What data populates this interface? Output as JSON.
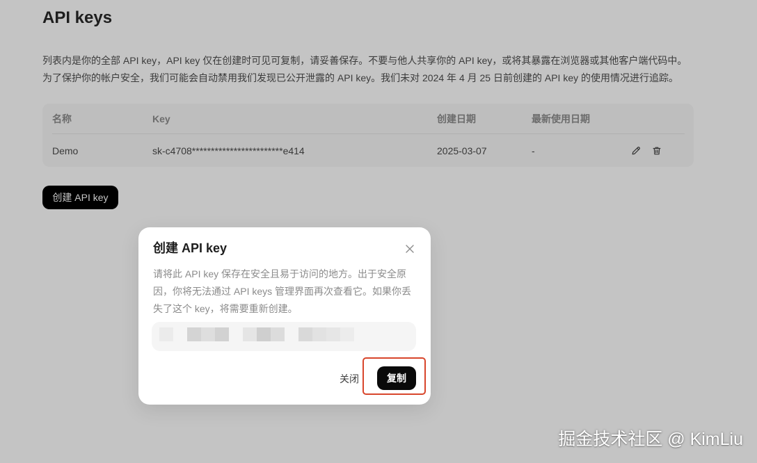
{
  "page": {
    "title": "API keys",
    "description_lines": [
      "列表内是你的全部 API key，API key 仅在创建时可见可复制，请妥善保存。不要与他人共享你的 API key，或将其暴露在浏览器或其他客户端代码中。",
      "为了保护你的帐户安全，我们可能会自动禁用我们发现已公开泄露的 API key。我们未对 2024 年 4 月 25 日前创建的 API key 的使用情况进行追踪。"
    ]
  },
  "table": {
    "columns": [
      "名称",
      "Key",
      "创建日期",
      "最新使用日期"
    ],
    "rows": [
      {
        "name": "Demo",
        "key": "sk-c4708************************e414",
        "created_date": "2025-03-07",
        "last_used_date": "-",
        "action_icons": [
          "pencil-icon",
          "trash-icon"
        ]
      }
    ]
  },
  "create_button": {
    "label": "创建 API key"
  },
  "modal": {
    "title": "创建 API key",
    "close_icon": "close-icon",
    "body_lines": [
      "请将此 API key 保存在安全且易于访问的地方。出于安全原",
      "因，你将无法通过 API keys 管理界面再次查看它。如果你丢",
      "失了这个 key，将需要重新创建。"
    ],
    "close_label": "关闭",
    "copy_label": "复制"
  },
  "watermark": {
    "text": "掘金技术社区 @ KimLiu"
  },
  "colors": {
    "primary_button": "#000000",
    "annotation_highlight": "#d8452b",
    "backdrop": "rgba(0,0,0,0.23)"
  }
}
